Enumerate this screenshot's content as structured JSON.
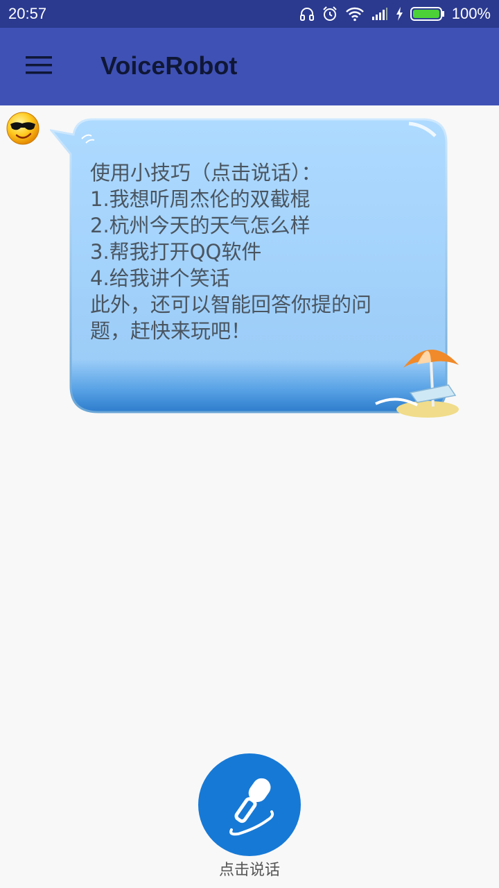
{
  "status_bar": {
    "time": "20:57",
    "battery": "100%",
    "icons": [
      "headset-icon",
      "alarm-icon",
      "wifi-icon",
      "signal-icon",
      "charging-icon",
      "battery-icon"
    ]
  },
  "app_bar": {
    "title": "VoiceRobot",
    "menu_icon": "hamburger-menu-icon",
    "color": "#3f51b5"
  },
  "chat": {
    "robot_avatar": "sunglasses-smiley-icon",
    "message_lines": [
      "使用小技巧（点击说话）：",
      "1.我想听周杰伦的双截棍",
      "2.杭州今天的天气怎么样",
      "3.帮我打开QQ软件",
      "4.给我讲个笑话",
      "此外，还可以智能回答你提的问",
      "题，赶快来玩吧！"
    ],
    "bubble_color": "#a6d3fb"
  },
  "voice_button": {
    "icon": "microphone-icon",
    "label": "点击说话",
    "color": "#1679d6"
  }
}
